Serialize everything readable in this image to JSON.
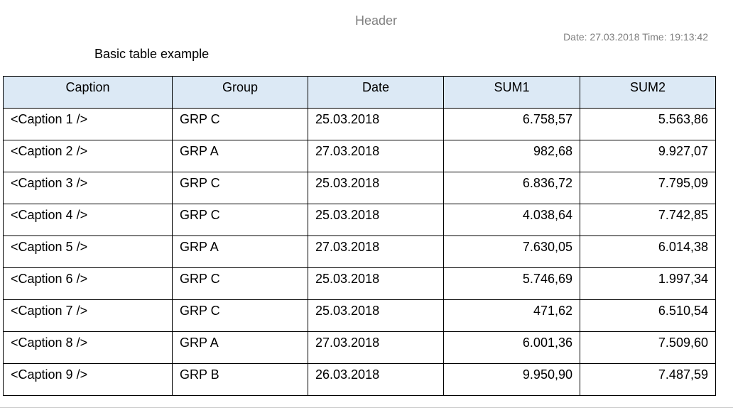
{
  "header": {
    "title": "Header",
    "timestamp": "Date: 27.03.2018 Time: 19:13:42"
  },
  "report": {
    "title": "Basic table example"
  },
  "table": {
    "columns": [
      "Caption",
      "Group",
      "Date",
      "SUM1",
      "SUM2"
    ],
    "rows": [
      [
        "<Caption 1 />",
        "GRP C",
        "25.03.2018",
        "6.758,57",
        "5.563,86"
      ],
      [
        "<Caption 2 />",
        "GRP A",
        "27.03.2018",
        "982,68",
        "9.927,07"
      ],
      [
        "<Caption 3 />",
        "GRP C",
        "25.03.2018",
        "6.836,72",
        "7.795,09"
      ],
      [
        "<Caption 4 />",
        "GRP C",
        "25.03.2018",
        "4.038,64",
        "7.742,85"
      ],
      [
        "<Caption 5 />",
        "GRP A",
        "27.03.2018",
        "7.630,05",
        "6.014,38"
      ],
      [
        "<Caption 6 />",
        "GRP C",
        "25.03.2018",
        "5.746,69",
        "1.997,34"
      ],
      [
        "<Caption 7 />",
        "GRP C",
        "25.03.2018",
        "471,62",
        "6.510,54"
      ],
      [
        "<Caption 8 />",
        "GRP A",
        "27.03.2018",
        "6.001,36",
        "7.509,60"
      ],
      [
        "<Caption 9 />",
        "GRP B",
        "26.03.2018",
        "9.950,90",
        "7.487,59"
      ]
    ]
  },
  "colors": {
    "header_text": "#7f7f7f",
    "table_header_bg": "#dce9f5",
    "border": "#000000"
  }
}
